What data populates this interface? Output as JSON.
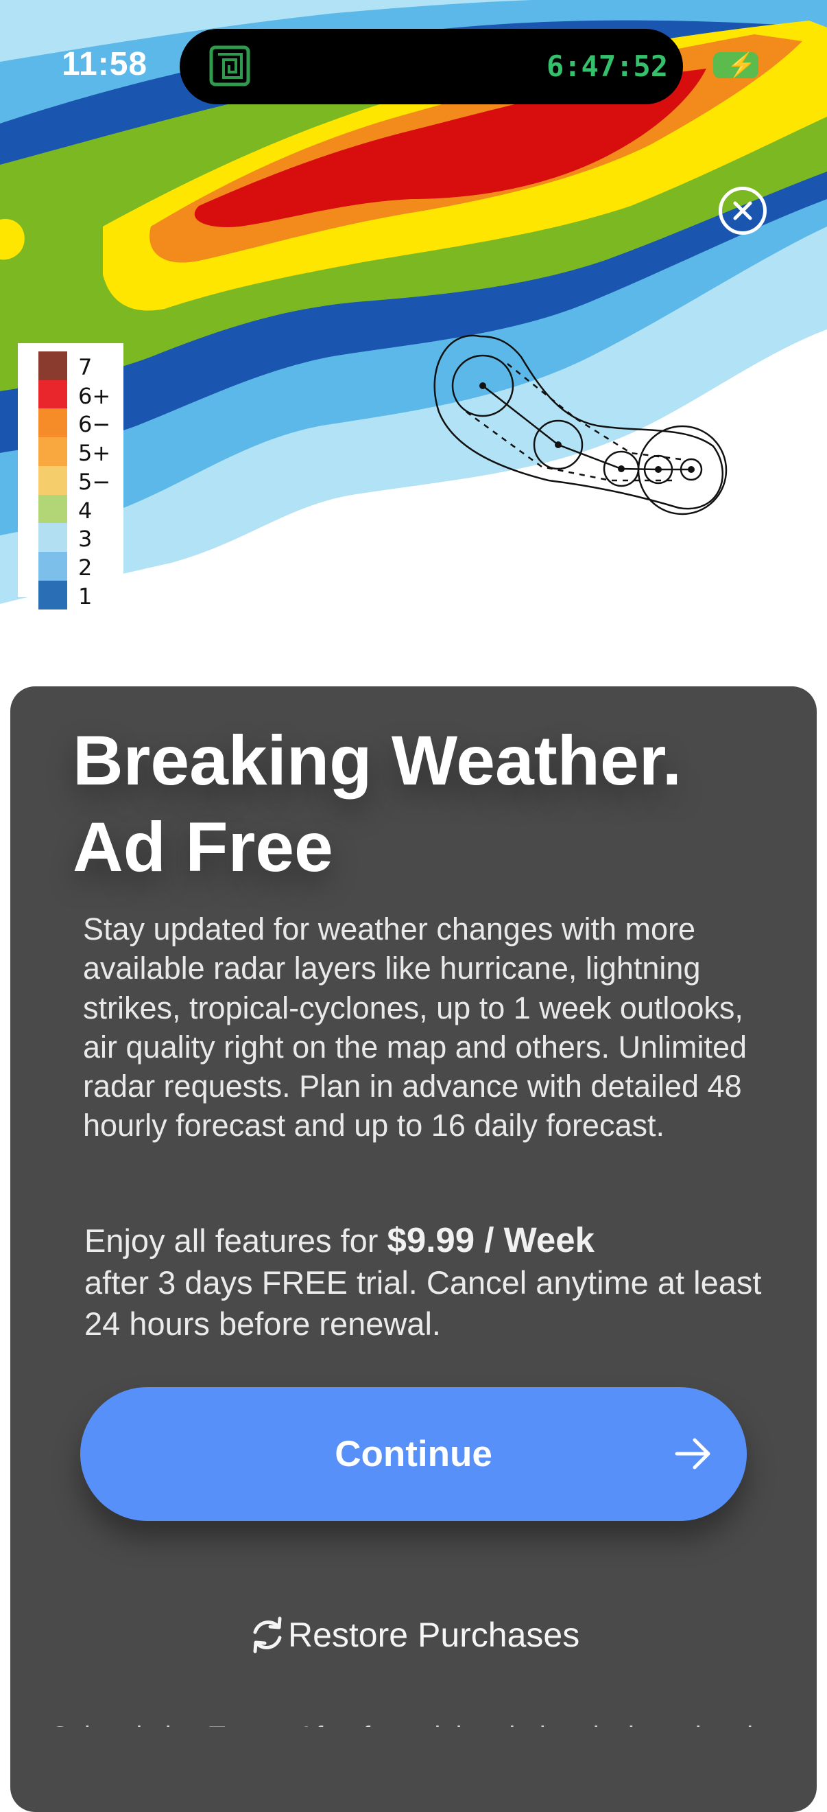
{
  "status_bar": {
    "time": "11:58",
    "live_activity_timer": "6:47:52",
    "app_icon": "maze-app-icon",
    "battery_icon": "battery-charging-icon"
  },
  "radar": {
    "close_icon": "close-circle-icon",
    "legend": [
      {
        "label": "7",
        "color": "#8b3a2e"
      },
      {
        "label": "6+",
        "color": "#e8262b"
      },
      {
        "label": "6−",
        "color": "#f58c28"
      },
      {
        "label": "5+",
        "color": "#f9a73f"
      },
      {
        "label": "5−",
        "color": "#f6cd6b"
      },
      {
        "label": "4",
        "color": "#b2d575"
      },
      {
        "label": "3",
        "color": "#b2dff2"
      },
      {
        "label": "2",
        "color": "#7cbfea"
      },
      {
        "label": "1",
        "color": "#2a6fb5"
      }
    ],
    "colors": {
      "light_blue": "#b2e2f5",
      "mid_blue": "#5cb8e8",
      "dark_blue": "#1a55b0",
      "green": "#7cb822",
      "yellow": "#ffe600",
      "orange": "#f38a1c",
      "red": "#d80e0e"
    }
  },
  "paywall": {
    "headline_line1": "Breaking Weather.",
    "headline_line2": "Ad Free",
    "description": "Stay updated for weather changes with more available radar layers like hurricane, lightning strikes, tropical-cyclones, up to 1 week outlooks, air quality right on the map and others. Unlimited radar requests. Plan in advance with detailed 48 hourly forecast and up to 16 daily forecast.",
    "offer_prefix": "Enjoy all features for ",
    "offer_price": "$9.99 / Week",
    "offer_suffix": "after 3 days FREE trial. Cancel anytime at least 24 hours before renewal.",
    "continue_label": "Continue",
    "continue_icon": "arrow-right-icon",
    "restore_label": "Restore Purchases",
    "restore_icon": "refresh-icon",
    "fine_print": "Subscription Terms: After free trial period ends the subscription will"
  },
  "accent": {
    "sheet_bg": "#4a4a4a",
    "button_bg": "#5690f8",
    "timer_green": "#35c06b"
  }
}
